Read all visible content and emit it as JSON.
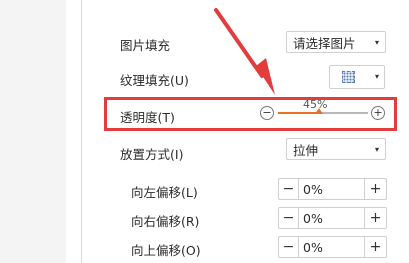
{
  "picture_fill": {
    "label": "图片填充",
    "value": "请选择图片"
  },
  "texture_fill": {
    "label": "纹理填充(U)",
    "icon": "texture-pattern-icon"
  },
  "transparency": {
    "label": "透明度(T)",
    "value_text": "45%",
    "value": 0.45
  },
  "placement": {
    "label": "放置方式(I)",
    "value": "拉伸"
  },
  "offsets": [
    {
      "label": "向左偏移(L)",
      "value": "0%"
    },
    {
      "label": "向右偏移(R)",
      "value": "0%"
    },
    {
      "label": "向上偏移(O)",
      "value": "0%"
    }
  ],
  "symbols": {
    "minus": "−",
    "plus": "+",
    "caret": "▾"
  },
  "colors": {
    "accent": "#e8721e",
    "highlight": "#e23c3c"
  }
}
